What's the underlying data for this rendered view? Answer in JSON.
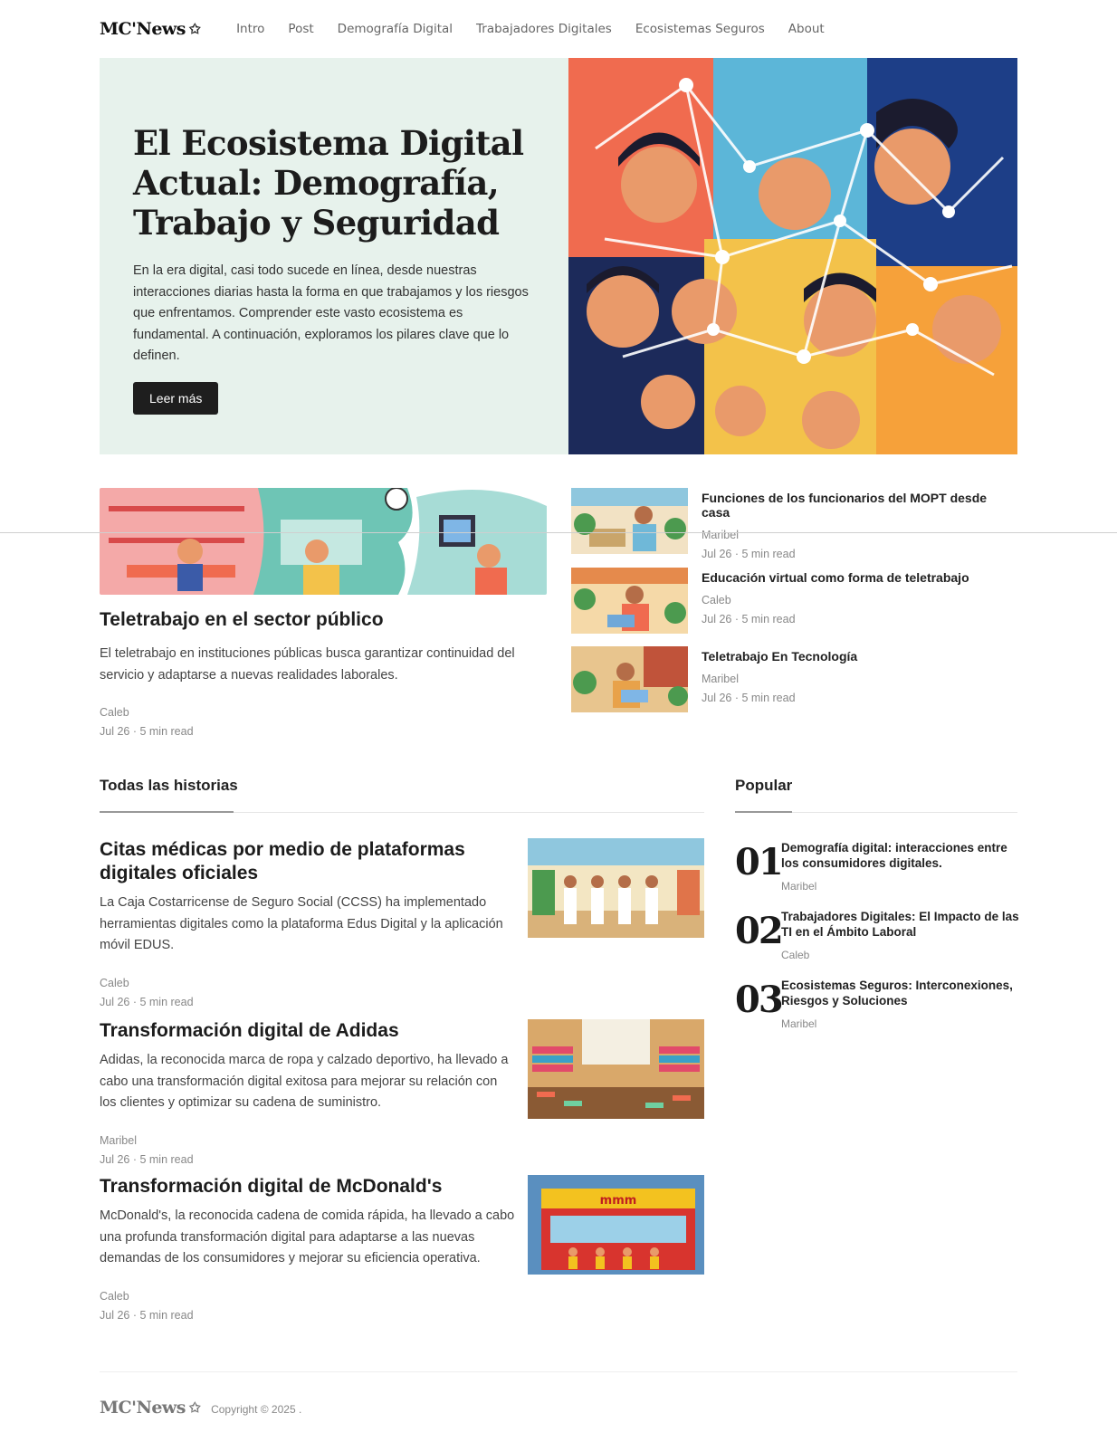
{
  "nav": {
    "logo": "MC'News",
    "logo_icon": "star-icon",
    "links": [
      "Intro",
      "Post",
      "Demografía Digital",
      "Trabajadores Digitales",
      "Ecosistemas Seguros",
      "About"
    ]
  },
  "hero": {
    "title": "El Ecosistema Digital Actual: Demografía, Trabajo y Seguridad",
    "description": "En la era digital, casi todo sucede en línea, desde nuestras interacciones diarias hasta la forma en que trabajamos y los riesgos que enfrentamos. Comprender este vasto ecosistema es fundamental. A continuación, exploramos los pilares clave que lo definen.",
    "button": "Leer más"
  },
  "featured": {
    "title": "Teletrabajo en el sector público",
    "description": "El teletrabajo en instituciones públicas busca garantizar continuidad del servicio y adaptarse a nuevas realidades laborales.",
    "author": "Caleb",
    "meta": "Jul 26 · 5 min read"
  },
  "side_posts": [
    {
      "title": "Funciones de los funcionarios del MOPT desde casa",
      "author": "Maribel",
      "meta": "Jul 26 · 5 min read"
    },
    {
      "title": "Educación virtual como forma de teletrabajo",
      "author": "Caleb",
      "meta": "Jul 26 · 5 min read"
    },
    {
      "title": "Teletrabajo En Tecnología",
      "author": "Maribel",
      "meta": "Jul 26 · 5 min read"
    }
  ],
  "all_stories": {
    "heading": "Todas las historias",
    "items": [
      {
        "title": "Citas médicas por medio de plataformas digitales oficiales",
        "description": "La Caja Costarricense de Seguro Social (CCSS) ha implementado herramientas digitales como la plataforma Edus Digital y la aplicación móvil EDUS.",
        "author": "Caleb",
        "meta": "Jul 26 · 5 min read"
      },
      {
        "title": "Transformación digital de Adidas",
        "description": "Adidas, la reconocida marca de ropa y calzado deportivo, ha llevado a cabo una transformación digital exitosa para mejorar su relación con los clientes y optimizar su cadena de suministro.",
        "author": "Maribel",
        "meta": "Jul 26 · 5 min read"
      },
      {
        "title": "Transformación digital de McDonald's",
        "description": "McDonald's, la reconocida cadena de comida rápida, ha llevado a cabo una profunda transformación digital para adaptarse a las nuevas demandas de los consumidores y mejorar su eficiencia operativa.",
        "author": "Caleb",
        "meta": "Jul 26 · 5 min read"
      }
    ]
  },
  "popular": {
    "heading": "Popular",
    "items": [
      {
        "num": "01",
        "title": "Demografía digital: interacciones entre los consumidores digitales.",
        "author": "Maribel"
      },
      {
        "num": "02",
        "title": "Trabajadores Digitales: El Impacto de las TI en el Ámbito Laboral",
        "author": "Caleb"
      },
      {
        "num": "03",
        "title": "Ecosistemas Seguros: Interconexiones, Riesgos y Soluciones",
        "author": "Maribel"
      }
    ]
  },
  "footer": {
    "logo": "MC'News",
    "copyright": "Copyright © 2025 ."
  }
}
